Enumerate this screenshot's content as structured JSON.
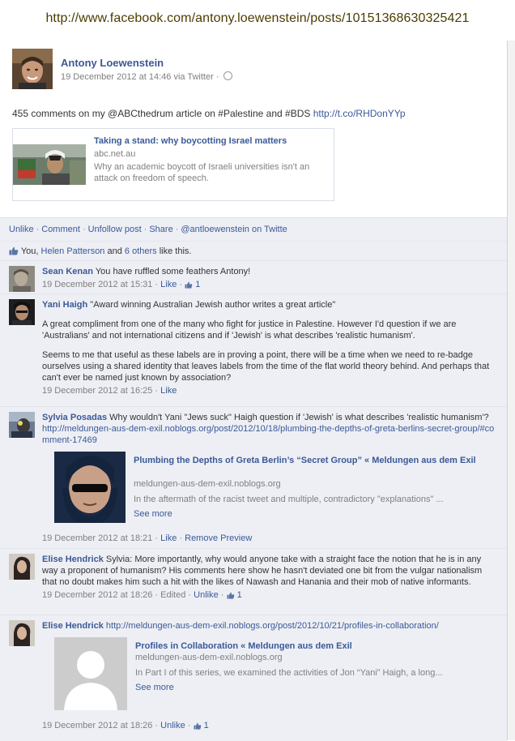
{
  "caption_url": "http://www.facebook.com/antony.loewenstein/posts/10151368630325421",
  "post": {
    "author": "Antony Loewenstein",
    "date": "19 December 2012 at 14:46",
    "via": "via Twitter ·",
    "status_text": "455 comments on my @ABCthedrum article on #Palestine and #BDS ",
    "status_link": "http://t.co/RHDonYYp"
  },
  "shared_link": {
    "title": "Taking a stand: why boycotting Israel matters",
    "domain": "abc.net.au",
    "description": "Why an academic boycott of Israeli universities isn't an attack on freedom of speech."
  },
  "actions": {
    "unlike": "Unlike",
    "comment": "Comment",
    "unfollow": "Unfollow post",
    "share": "Share",
    "twitter": "@antloewenstein on Twitte"
  },
  "likes": {
    "you": "You, ",
    "person": "Helen Patterson",
    "and": " and ",
    "others": "6 others",
    "suffix": " like this."
  },
  "comments": [
    {
      "name": "Sean Kenan",
      "text": " You have ruffled some feathers Antony!",
      "date": "19 December 2012 at 15:31",
      "action": "Like",
      "like_count": "1"
    },
    {
      "name": "Yani Haigh",
      "text": " \"Award winning Australian Jewish author writes a great article\"",
      "para1": "A great compliment from one of the many who fight for justice in Palestine. However I'd question if we are 'Australians' and not international citizens and if 'Jewish' is what describes 'realistic humanism'.",
      "para2": "Seems to me that useful as these labels are in proving a point, there will be a time when we need to re-badge ourselves using a shared identity that leaves labels from the time of the flat world theory behind. And perhaps that can't ever be named just known by association?",
      "date": "19 December 2012 at 16:25",
      "action": "Like"
    },
    {
      "name": "Sylvia Posadas",
      "text": " Why wouldn't Yani \"Jews suck\" Haigh question if 'Jewish' is what describes 'realistic humanism'? ",
      "url": "http://meldungen-aus-dem-exil.noblogs.org/post/2012/10/18/plumbing-the-depths-of-greta-berlins-secret-group/#comment-17469",
      "attach_title": "Plumbing the Depths of Greta Berlin’s “Secret Group” « Meldungen aus dem Exil",
      "attach_domain": "meldungen-aus-dem-exil.noblogs.org",
      "attach_desc": "In the aftermath of the racist tweet and multiple, contradictory \"explanations\" ...",
      "see_more": "See more",
      "date": "19 December 2012 at 18:21",
      "action": "Like",
      "remove": "Remove Preview"
    },
    {
      "name": "Elise Hendrick",
      "text": " Sylvia: More importantly, why would anyone take with a straight face the notion that he is in any way a proponent of humanism? His comments here show he hasn't deviated one bit from the vulgar nationalism that no doubt makes him such a hit with the likes of Nawash and Hanania and their mob of native informants.",
      "date": "19 December 2012 at 18:26",
      "edited": "Edited",
      "action": "Unlike",
      "like_count": "1"
    },
    {
      "name": "Elise Hendrick",
      "url": "http://meldungen-aus-dem-exil.noblogs.org/post/2012/10/21/profiles-in-collaboration/",
      "attach_title": "Profiles in Collaboration « Meldungen aus dem Exil",
      "attach_domain": "meldungen-aus-dem-exil.noblogs.org",
      "attach_desc": "In Part I of this series, we examined the activities of Jon “Yani” Haigh, a long...",
      "see_more": "See more",
      "date": "19 December 2012 at 18:26",
      "action": "Unlike",
      "like_count": "1"
    }
  ],
  "colors": {
    "link": "#3b5998",
    "comment_bg": "#edeff4",
    "meta": "#808080",
    "caption": "#4b3d00"
  }
}
